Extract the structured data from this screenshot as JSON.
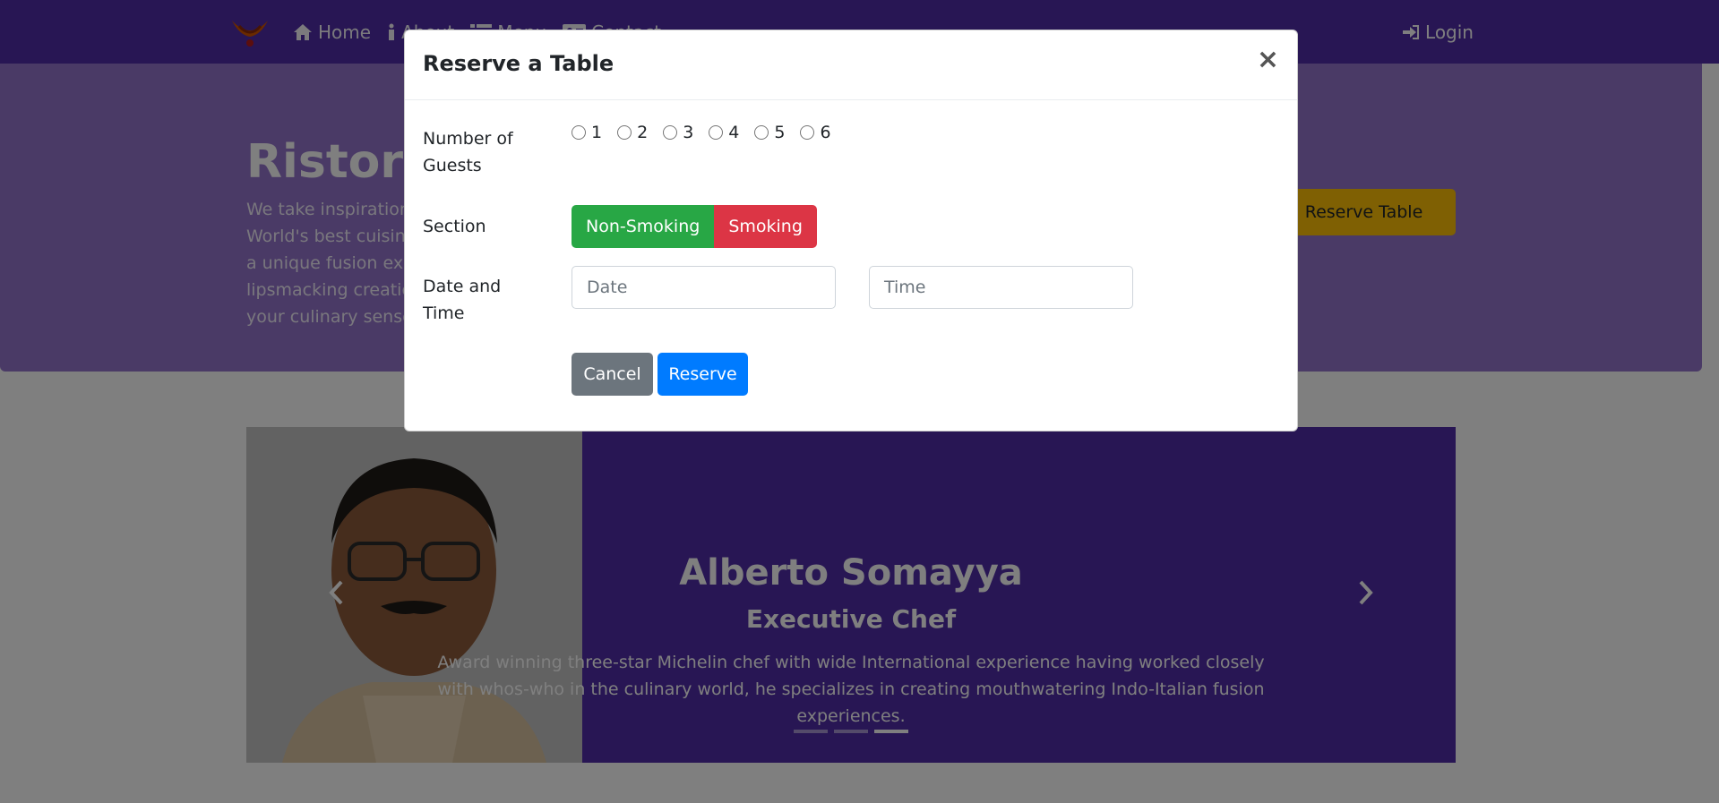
{
  "navbar": {
    "links": [
      {
        "label": "Home",
        "icon": "home-icon"
      },
      {
        "label": "About",
        "icon": "info-icon"
      },
      {
        "label": "Menu",
        "icon": "list-icon"
      },
      {
        "label": "Contact",
        "icon": "address-card-icon"
      }
    ],
    "login_label": "Login",
    "login_icon": "sign-in-icon"
  },
  "jumbotron": {
    "title": "Ristorante con Fusion",
    "text": "We take inspiration from the World's best cuisines, and create a unique fusion experience. Our lipsmacking creations will tickle your culinary senses!",
    "reserve_button": "Reserve Table"
  },
  "carousel": {
    "name": "Alberto Somayya",
    "role": "Executive Chef",
    "description": "Award winning three-star Michelin chef with wide International experience having worked closely with whos-who in the culinary world, he specializes in creating mouthwatering Indo-Italian fusion experiences.",
    "active_slide": 3,
    "slide_count": 3
  },
  "modal": {
    "title": "Reserve a Table",
    "close_glyph": "×",
    "guests_label": "Number of Guests",
    "guest_options": [
      "1",
      "2",
      "3",
      "4",
      "5",
      "6"
    ],
    "section_label": "Section",
    "sections": [
      "Non-Smoking",
      "Smoking"
    ],
    "datetime_label": "Date and Time",
    "date_placeholder": "Date",
    "time_placeholder": "Time",
    "cancel_label": "Cancel",
    "reserve_label": "Reserve"
  },
  "colors": {
    "primary": "#512da8",
    "light_primary": "#9575cd",
    "warning": "#ffc107",
    "success": "#28a745",
    "danger": "#dc3545",
    "secondary": "#6c757d",
    "blue": "#007bff"
  }
}
